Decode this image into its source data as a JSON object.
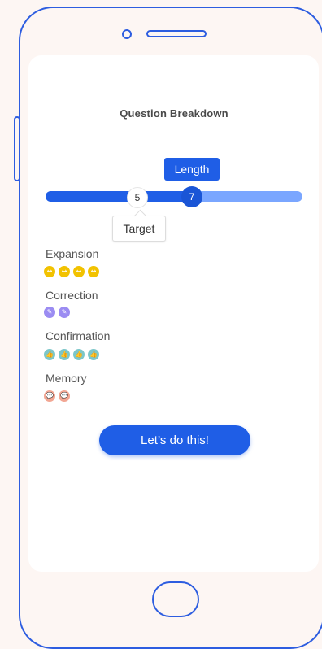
{
  "screen": {
    "title": "Question Breakdown",
    "slider": {
      "badge_label": "Length",
      "value": 7,
      "value_label": "7",
      "target": 5,
      "target_label": "5",
      "tooltip": "Target",
      "fill_fraction": 0.57
    },
    "categories": [
      {
        "label": "Expansion",
        "icon": "expand-arrows-icon",
        "glyph": "↔",
        "count": 4,
        "color": "#f2c200"
      },
      {
        "label": "Correction",
        "icon": "pencil-icon",
        "glyph": "✎",
        "count": 2,
        "color": "#9b8cf2"
      },
      {
        "label": "Confirmation",
        "icon": "thumbs-up-icon",
        "glyph": "👍",
        "count": 4,
        "color": "#7cc7c9"
      },
      {
        "label": "Memory",
        "icon": "speech-bubble-icon",
        "glyph": "💬",
        "count": 2,
        "color": "#f2a693"
      }
    ],
    "cta_label": "Let’s do this!"
  },
  "colors": {
    "accent": "#1f5ee6",
    "track": "#7aa6ff",
    "frame": "#2d5de0",
    "background": "#fdf6f3"
  }
}
